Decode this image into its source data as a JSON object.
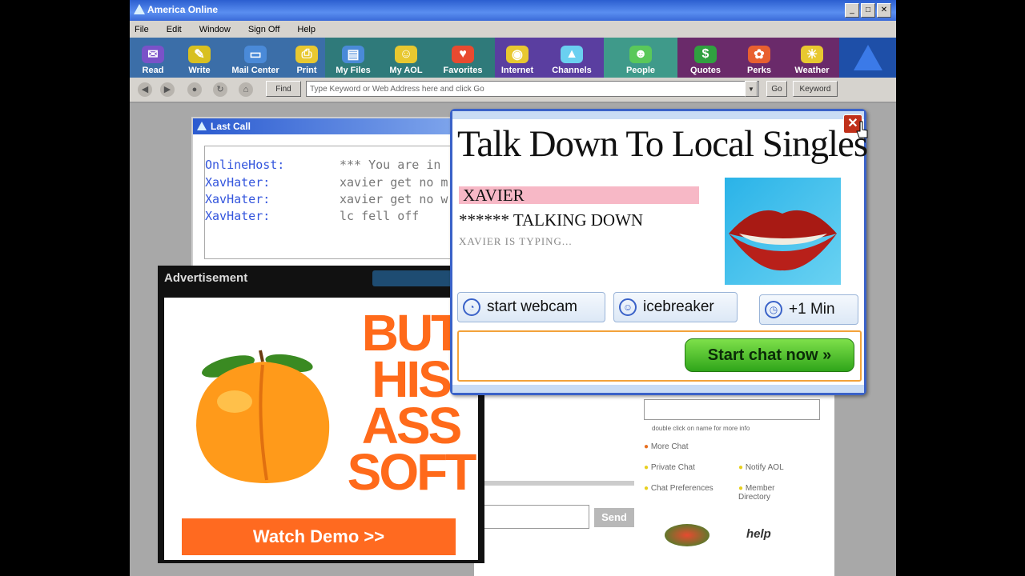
{
  "window": {
    "title": "America Online",
    "buttons": [
      "_",
      "□",
      "✕"
    ]
  },
  "menu": [
    "File",
    "Edit",
    "Window",
    "Sign Off",
    "Help"
  ],
  "toolbar": [
    {
      "label": "Read",
      "icon": "mail-icon",
      "color": "#7a52c8"
    },
    {
      "label": "Write",
      "icon": "pencil-icon",
      "color": "#d8c020"
    },
    {
      "label": "Mail Center",
      "icon": "mailbox-icon",
      "color": "#4a8ad8"
    },
    {
      "label": "Print",
      "icon": "printer-icon",
      "color": "#e8c830"
    },
    {
      "label": "My Files",
      "icon": "files-icon",
      "color": "#4a8ad8"
    },
    {
      "label": "My AOL",
      "icon": "person-icon",
      "color": "#e8c830"
    },
    {
      "label": "Favorites",
      "icon": "heart-icon",
      "color": "#e84a30"
    },
    {
      "label": "Internet",
      "icon": "globe-icon",
      "color": "#e8c830"
    },
    {
      "label": "Channels",
      "icon": "channels-icon",
      "color": "#6ad0f0"
    },
    {
      "label": "People",
      "icon": "people-icon",
      "color": "#5ac85a"
    },
    {
      "label": "Quotes",
      "icon": "dollar-icon",
      "color": "#30a040"
    },
    {
      "label": "Perks",
      "icon": "gift-icon",
      "color": "#e86030"
    },
    {
      "label": "Weather",
      "icon": "sun-icon",
      "color": "#e8c830"
    }
  ],
  "address": {
    "find_label": "Find",
    "placeholder": "Type Keyword or Web Address here and click Go",
    "go_label": "Go",
    "keyword_label": "Keyword"
  },
  "chat_window": {
    "title": "Last Call",
    "messages": [
      {
        "who": "OnlineHost:",
        "msg": "*** You are in"
      },
      {
        "who": "XavHater:",
        "msg": "xavier get no m"
      },
      {
        "who": "XavHater:",
        "msg": "xavier get no w"
      },
      {
        "who": "XavHater:",
        "msg": "lc fell off"
      }
    ],
    "list_hint": "double click on name for more info",
    "options": [
      "More Chat",
      "Private Chat",
      "Notify AOL",
      "Chat Preferences",
      "Member Directory"
    ],
    "send_label": "Send",
    "help_label": "help"
  },
  "advertisement": {
    "header": "Advertisement",
    "headline_lines": [
      "BUT",
      "HIS",
      "ASS",
      "SOFT"
    ],
    "cta": "Watch Demo >>"
  },
  "popup": {
    "title": "Talk Down To Local Singles",
    "name": "XAVIER",
    "status": "****** TALKING DOWN",
    "typing": "XAVIER IS TYPING...",
    "buttons": {
      "webcam": "start webcam",
      "icebreaker": "icebreaker",
      "min": "+1 Min"
    },
    "start_chat": "Start chat now »",
    "close": "✕"
  },
  "colors": {
    "ad_orange": "#ff6a1a",
    "popup_border": "#3a62c8",
    "start_green": "#3cb524",
    "name_pink": "#f7b8c6"
  }
}
